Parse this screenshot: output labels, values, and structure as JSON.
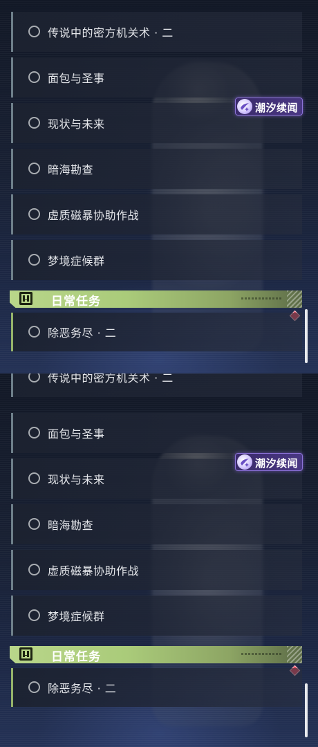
{
  "frames": [
    {
      "quests": [
        "传说中的密方机关术 · 二",
        "面包与圣事",
        "现状与未来",
        "暗海勘查",
        "虚质磁暴协助作战",
        "梦境症候群"
      ],
      "event_badge": {
        "label": "潮汐续闻",
        "icon": "tide-story-icon",
        "color": "#4a3884"
      },
      "daily_section": {
        "title": "日常任务",
        "icon": "exclamation-icon",
        "color": "#b9d68a"
      },
      "daily_quests": [
        "除恶务尽 · 二"
      ],
      "alert_icon": "red-diamond-icon"
    },
    {
      "quests": [
        "传说中的密方机关术 · 二",
        "面包与圣事",
        "现状与未来",
        "暗海勘查",
        "虚质磁暴协助作战",
        "梦境症候群"
      ],
      "event_badge": {
        "label": "潮汐续闻",
        "icon": "tide-story-icon",
        "color": "#4a3884"
      },
      "daily_section": {
        "title": "日常任务",
        "icon": "exclamation-icon",
        "color": "#b9d68a"
      },
      "daily_quests": [
        "除恶务尽 · 二"
      ],
      "alert_icon": "red-diamond-icon"
    }
  ]
}
